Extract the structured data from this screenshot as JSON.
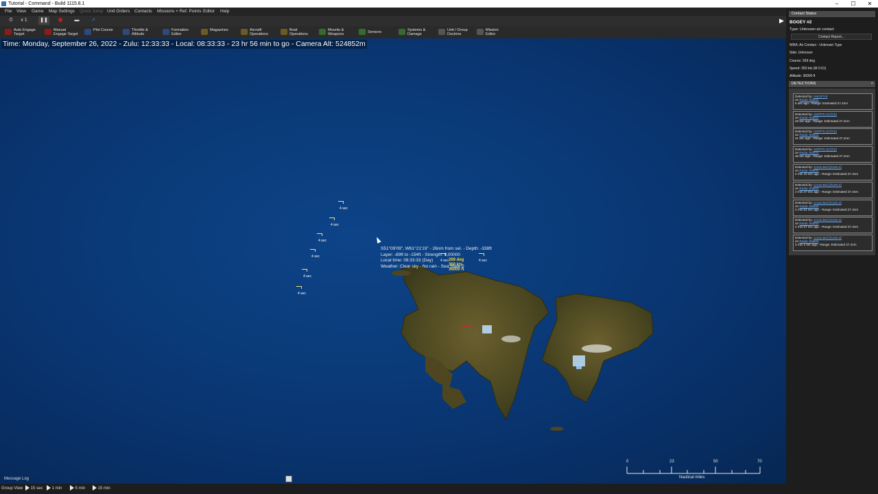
{
  "window": {
    "title": "Tutorial - Command - Build 1115.8.1",
    "controls": [
      "–",
      "☐",
      "✕"
    ]
  },
  "menu": [
    "File",
    "View",
    "Game",
    "Map Settings",
    "Quick Jump",
    "Unit Orders",
    "Contacts",
    "Missions + Ref. Points",
    "Editor",
    "Help"
  ],
  "menu_disabled": "Quick Jump",
  "toolbar": {
    "speed": "x 1",
    "buttons": [
      {
        "label": "Auto Engage\nTarget",
        "color": "#8b1c1c"
      },
      {
        "label": "Manual\nEngage Target",
        "color": "#8b1c1c"
      },
      {
        "label": "Plot Course",
        "color": "#2d4a7a"
      },
      {
        "label": "Throttle &\nAltitude",
        "color": "#2d4a7a"
      },
      {
        "label": "Formation\nEditor",
        "color": "#2d4a7a"
      },
      {
        "label": "Magazines",
        "color": "#6a5a25"
      },
      {
        "label": "Aircraft\nOperations",
        "color": "#6a5a25"
      },
      {
        "label": "Boat\nOperations",
        "color": "#6a5a25"
      },
      {
        "label": "Mounts &\nWeapons",
        "color": "#356b2c"
      },
      {
        "label": "Sensors",
        "color": "#356b2c"
      },
      {
        "label": "Systems &\nDamage",
        "color": "#356b2c"
      },
      {
        "label": "Unit / Group\nDoctrine",
        "color": "#3a3a3a"
      },
      {
        "label": "Mission\nEditor",
        "color": "#3a3a3a"
      }
    ]
  },
  "status": {
    "time_line": "Time: Monday, September 26, 2022 - Zulu: 12:33:33 - Local: 08:33:33 - 23 hr 56 min to go -  Camera Alt: 524852m"
  },
  "map": {
    "tracks": [
      {
        "label": "4 sec"
      },
      {
        "label": "4 sec"
      },
      {
        "label": "4 sec"
      },
      {
        "label": "4 sec"
      },
      {
        "label": "4 sec"
      },
      {
        "label": "4 sec"
      }
    ],
    "tooltip": [
      "S51°09'09\", W61°21'19\" - 26nm from sel. - Depth: -338ft",
      "Layer: -89ft to -154ft - Strength: 0,00000",
      "Local time: 08:33:33 (Day)",
      "Weather: Clear sky - No rain - Sea State 0"
    ],
    "contact_labels": [
      "269 deg",
      "350 kts",
      "36000 ft"
    ],
    "contact_time_labels": [
      "4 sec",
      "4 sec"
    ]
  },
  "scale": {
    "ticks": [
      "0",
      "23",
      "50",
      "70"
    ],
    "unit": "Nautical miles"
  },
  "message_log": "Message Log",
  "bottom": {
    "group_view": "Group View",
    "steps": [
      "15 sec",
      "1 min",
      "5 min",
      "15 min"
    ]
  },
  "contact_status": {
    "header": "Contact Status",
    "name": "BOGEY #2",
    "type": "Type: Unknown air contact",
    "report_button": "Contact Report...",
    "wra": "WRA: Air Contact - Unknown Type",
    "side": "Side: Unknown",
    "course": "Course: 269 deg",
    "speed": "Speed: 350 kts (M 0.61)",
    "altitude": "Altitude: 36000 ft"
  },
  "detections": {
    "header": "DETECTIONS",
    "items": [
      {
        "sensor": "AN/APY-9",
        "platform": "Radar Station",
        "ago": "6 sec ago",
        "range": "- Range: Estimated 27.4nm"
      },
      {
        "sensor": "AN/FPS-117(V)3",
        "platform": "Radar Station",
        "ago": "26 sec ago",
        "range": "- Range: Estimated 27.4nm"
      },
      {
        "sensor": "AN/FPS-117(V)3",
        "platform": "Radar Station",
        "ago": "31 sec ago",
        "range": "- Range: Estimated 27.4nm"
      },
      {
        "sensor": "AN/FPS-117(V)3",
        "platform": "Radar Station",
        "ago": "36 sec ago",
        "range": "- Range: Estimated 27.4nm"
      },
      {
        "sensor": "Cross Bed [GUIS-2]",
        "platform": "Radar Station",
        "ago": "2 min 42 sec ago",
        "range": "- Range: Estimated 27.4nm"
      },
      {
        "sensor": "Cross Bed [GUIS-2]",
        "platform": "Radar Station",
        "ago": "2 min 47 sec ago",
        "range": "- Range: Estimated 27.4nm"
      },
      {
        "sensor": "Cross Bed [GUIS-2]",
        "platform": "Radar Station",
        "ago": "2 min 52 sec ago",
        "range": "- Range: Estimated 27.4nm"
      },
      {
        "sensor": "Cross Bed [GUIS-2]",
        "platform": "Radar Station",
        "ago": "2 min 57 sec ago",
        "range": "- Range: Estimated 27.4nm"
      },
      {
        "sensor": "Cross Bed [GUIS-2]",
        "platform": "Radar Station",
        "ago": "3 min 2 sec ago",
        "range": "- Range: Estimated 27.4nm"
      }
    ],
    "detected_by": "Detected by:",
    "on": "on"
  }
}
